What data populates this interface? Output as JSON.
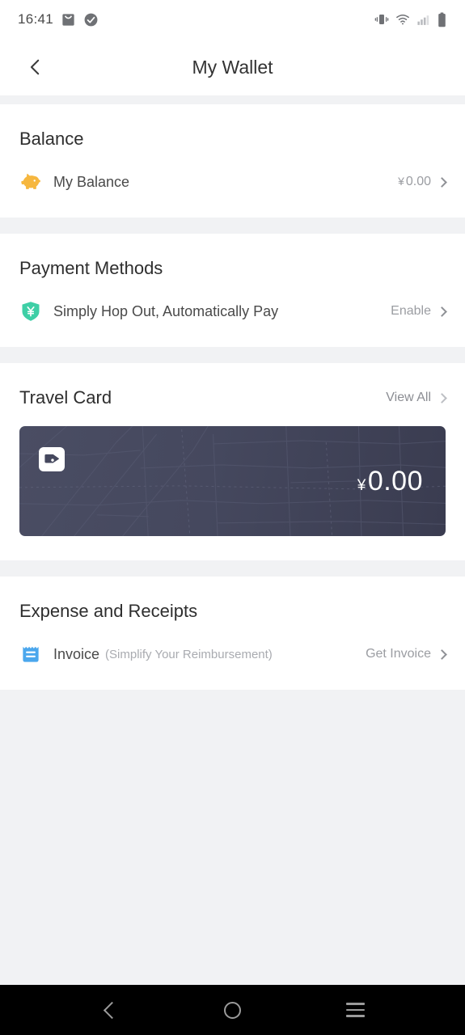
{
  "status_bar": {
    "time": "16:41",
    "left_icons": [
      "mail-icon",
      "check-circle-icon"
    ],
    "right_icons": [
      "vibrate-icon",
      "wifi-icon",
      "signal-icon",
      "battery-icon"
    ]
  },
  "header": {
    "title": "My Wallet",
    "back_icon": "back-chevron-icon"
  },
  "sections": {
    "balance": {
      "title": "Balance",
      "row": {
        "icon": "piggy-bank-icon",
        "label": "My Balance",
        "currency": "¥",
        "value": "0.00"
      }
    },
    "payment_methods": {
      "title": "Payment Methods",
      "row": {
        "icon": "shield-yen-icon",
        "label": "Simply Hop Out, Automatically Pay",
        "action": "Enable"
      }
    },
    "travel_card": {
      "title": "Travel Card",
      "action": "View All",
      "card": {
        "icon": "wallet-card-icon",
        "currency": "¥",
        "amount": "0.00"
      }
    },
    "expense_receipts": {
      "title": "Expense and Receipts",
      "row": {
        "icon": "invoice-icon",
        "label": "Invoice",
        "sub_label": "(Simplify Your Reimbursement)",
        "action": "Get Invoice"
      }
    }
  },
  "nav_bar": {
    "back": "nav-back-icon",
    "home": "nav-home-icon",
    "recents": "nav-recents-icon"
  },
  "colors": {
    "page_bg": "#f1f2f4",
    "card_bg": "#45485e",
    "piggy": "#f6b73f",
    "shield": "#3ecfa6",
    "invoice": "#4ba7ed"
  }
}
